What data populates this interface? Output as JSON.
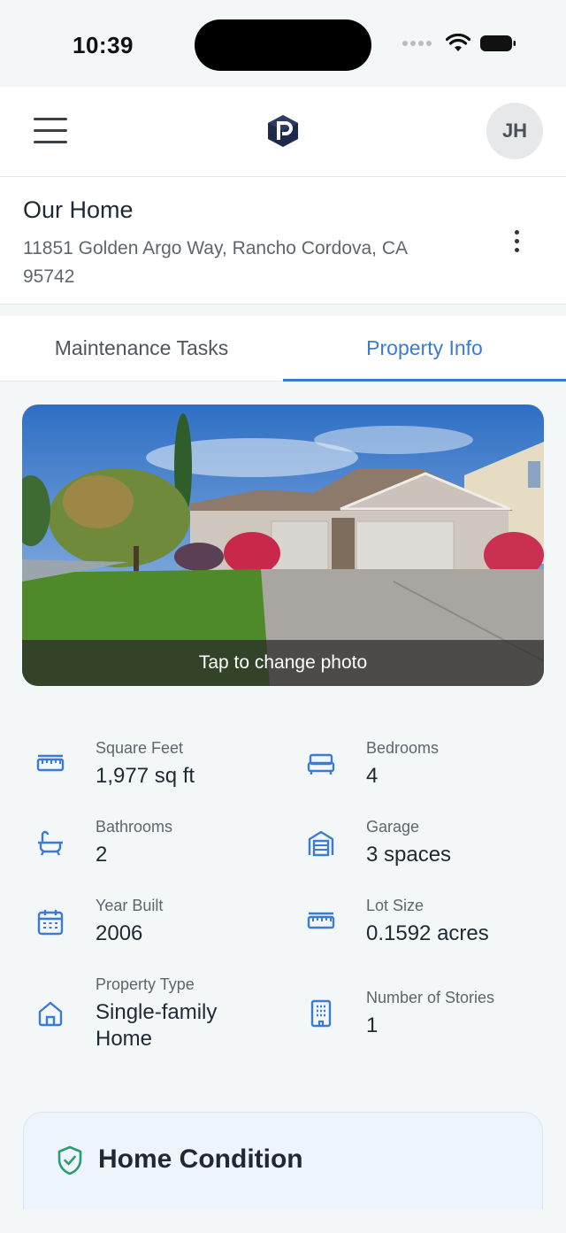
{
  "status_bar": {
    "time": "10:39"
  },
  "header": {
    "avatar_initials": "JH"
  },
  "home": {
    "title": "Our Home",
    "address": "11851 Golden Argo Way, Rancho Cordova, CA 95742"
  },
  "tabs": [
    {
      "label": "Maintenance Tasks",
      "active": false
    },
    {
      "label": "Property Info",
      "active": true
    }
  ],
  "photo": {
    "overlay_text": "Tap to change photo"
  },
  "property_info": [
    {
      "label": "Square Feet",
      "value": "1,977 sq ft",
      "icon": "ruler-icon"
    },
    {
      "label": "Bedrooms",
      "value": "4",
      "icon": "bed-icon"
    },
    {
      "label": "Bathrooms",
      "value": "2",
      "icon": "bathtub-icon"
    },
    {
      "label": "Garage",
      "value": "3 spaces",
      "icon": "garage-icon"
    },
    {
      "label": "Year Built",
      "value": "2006",
      "icon": "calendar-icon"
    },
    {
      "label": "Lot Size",
      "value": "0.1592 acres",
      "icon": "ruler-icon"
    },
    {
      "label": "Property Type",
      "value": "Single-family Home",
      "icon": "house-icon"
    },
    {
      "label": "Number of Stories",
      "value": "1",
      "icon": "building-icon"
    }
  ],
  "condition": {
    "title": "Home Condition"
  },
  "colors": {
    "accent": "#3a7bd5",
    "condition_icon": "#2a9d6f"
  }
}
